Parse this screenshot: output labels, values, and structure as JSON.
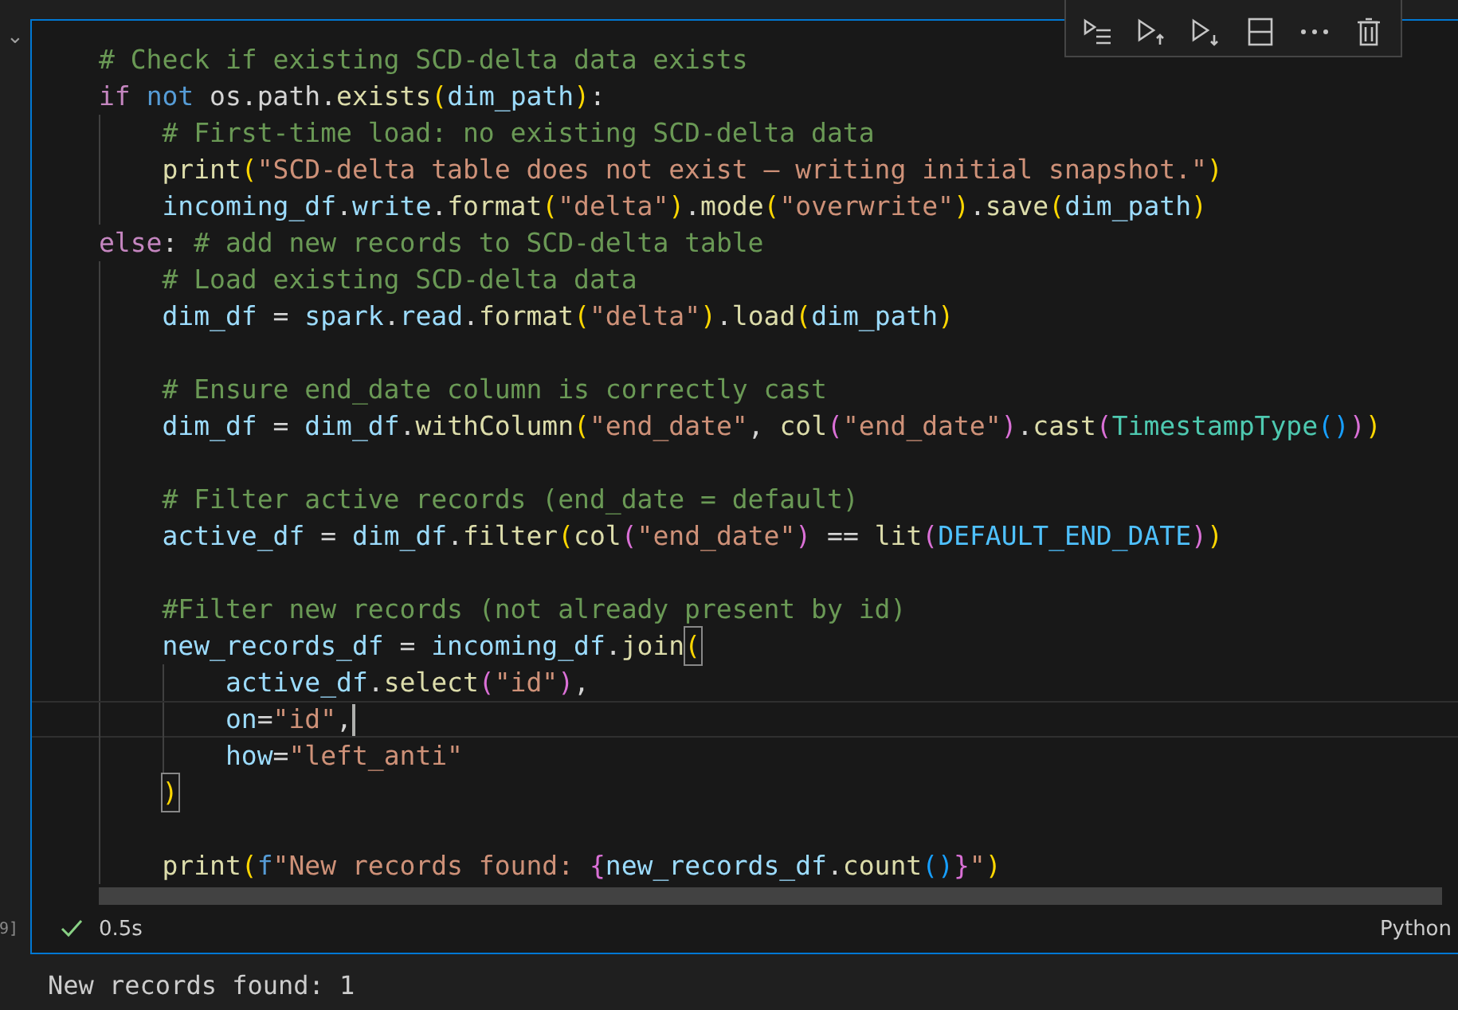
{
  "gutter": {
    "collapse": "⌄",
    "execution_count": "9]"
  },
  "toolbar": {
    "buttons": [
      {
        "kind": "run-by-line"
      },
      {
        "kind": "run-above"
      },
      {
        "kind": "run-below"
      },
      {
        "kind": "split"
      },
      {
        "kind": "more"
      },
      {
        "kind": "delete"
      }
    ]
  },
  "code": {
    "lines": [
      {
        "tokens": [
          {
            "text": "# Check if existing SCD-delta data exists",
            "kind": "comment"
          }
        ]
      },
      {
        "tokens": [
          {
            "text": "if ",
            "kind": "keyword"
          },
          {
            "text": "not",
            "kind": "storage"
          },
          {
            "text": " os.path.",
            "kind": "plain"
          },
          {
            "text": "exists",
            "kind": "func"
          },
          {
            "text": "(",
            "kind": "bracket1"
          },
          {
            "text": "dim_path",
            "kind": "var"
          },
          {
            "text": ")",
            "kind": "bracket1"
          },
          {
            "text": ":",
            "kind": "plain"
          }
        ]
      },
      {
        "tokens": [
          {
            "text": "    # First-time load: no existing SCD-delta data",
            "kind": "comment"
          }
        ]
      },
      {
        "tokens": [
          {
            "text": "    print",
            "kind": "func"
          },
          {
            "text": "(",
            "kind": "bracket1"
          },
          {
            "text": "\"SCD-delta table does not exist — writing initial snapshot.\"",
            "kind": "string"
          },
          {
            "text": ")",
            "kind": "bracket1"
          }
        ]
      },
      {
        "tokens": [
          {
            "text": "    incoming_df",
            "kind": "var"
          },
          {
            "text": ".",
            "kind": "plain"
          },
          {
            "text": "write",
            "kind": "var"
          },
          {
            "text": ".",
            "kind": "plain"
          },
          {
            "text": "format",
            "kind": "func"
          },
          {
            "text": "(",
            "kind": "bracket1"
          },
          {
            "text": "\"delta\"",
            "kind": "string"
          },
          {
            "text": ")",
            "kind": "bracket1"
          },
          {
            "text": ".",
            "kind": "plain"
          },
          {
            "text": "mode",
            "kind": "func"
          },
          {
            "text": "(",
            "kind": "bracket1"
          },
          {
            "text": "\"overwrite\"",
            "kind": "string"
          },
          {
            "text": ")",
            "kind": "bracket1"
          },
          {
            "text": ".",
            "kind": "plain"
          },
          {
            "text": "save",
            "kind": "func"
          },
          {
            "text": "(",
            "kind": "bracket1"
          },
          {
            "text": "dim_path",
            "kind": "var"
          },
          {
            "text": ")",
            "kind": "bracket1"
          }
        ]
      },
      {
        "tokens": [
          {
            "text": "else",
            "kind": "keyword"
          },
          {
            "text": ": ",
            "kind": "plain"
          },
          {
            "text": "# add new records to SCD-delta table",
            "kind": "comment"
          }
        ]
      },
      {
        "tokens": [
          {
            "text": "    # Load existing SCD-delta data",
            "kind": "comment"
          }
        ]
      },
      {
        "tokens": [
          {
            "text": "    dim_df",
            "kind": "var"
          },
          {
            "text": " = ",
            "kind": "plain"
          },
          {
            "text": "spark",
            "kind": "var"
          },
          {
            "text": ".",
            "kind": "plain"
          },
          {
            "text": "read",
            "kind": "var"
          },
          {
            "text": ".",
            "kind": "plain"
          },
          {
            "text": "format",
            "kind": "func"
          },
          {
            "text": "(",
            "kind": "bracket1"
          },
          {
            "text": "\"delta\"",
            "kind": "string"
          },
          {
            "text": ")",
            "kind": "bracket1"
          },
          {
            "text": ".",
            "kind": "plain"
          },
          {
            "text": "load",
            "kind": "func"
          },
          {
            "text": "(",
            "kind": "bracket1"
          },
          {
            "text": "dim_path",
            "kind": "var"
          },
          {
            "text": ")",
            "kind": "bracket1"
          }
        ]
      },
      {
        "kind": "blank"
      },
      {
        "tokens": [
          {
            "text": "    # Ensure end_date column is correctly cast",
            "kind": "comment"
          }
        ]
      },
      {
        "tokens": [
          {
            "text": "    dim_df",
            "kind": "var"
          },
          {
            "text": " = ",
            "kind": "plain"
          },
          {
            "text": "dim_df",
            "kind": "var"
          },
          {
            "text": ".",
            "kind": "plain"
          },
          {
            "text": "withColumn",
            "kind": "func"
          },
          {
            "text": "(",
            "kind": "bracket1"
          },
          {
            "text": "\"end_date\"",
            "kind": "string"
          },
          {
            "text": ", ",
            "kind": "plain"
          },
          {
            "text": "col",
            "kind": "func"
          },
          {
            "text": "(",
            "kind": "bracket2"
          },
          {
            "text": "\"end_date\"",
            "kind": "string"
          },
          {
            "text": ")",
            "kind": "bracket2"
          },
          {
            "text": ".",
            "kind": "plain"
          },
          {
            "text": "cast",
            "kind": "func"
          },
          {
            "text": "(",
            "kind": "bracket2"
          },
          {
            "text": "TimestampType",
            "kind": "class"
          },
          {
            "text": "()",
            "kind": "bracket3"
          },
          {
            "text": ")",
            "kind": "bracket2"
          },
          {
            "text": ")",
            "kind": "bracket1"
          }
        ]
      },
      {
        "kind": "blank"
      },
      {
        "tokens": [
          {
            "text": "    # Filter active records (end_date = default)",
            "kind": "comment"
          }
        ]
      },
      {
        "tokens": [
          {
            "text": "    active_df",
            "kind": "var"
          },
          {
            "text": " = ",
            "kind": "plain"
          },
          {
            "text": "dim_df",
            "kind": "var"
          },
          {
            "text": ".",
            "kind": "plain"
          },
          {
            "text": "filter",
            "kind": "func"
          },
          {
            "text": "(",
            "kind": "bracket1"
          },
          {
            "text": "col",
            "kind": "func"
          },
          {
            "text": "(",
            "kind": "bracket2"
          },
          {
            "text": "\"end_date\"",
            "kind": "string"
          },
          {
            "text": ")",
            "kind": "bracket2"
          },
          {
            "text": " == ",
            "kind": "plain"
          },
          {
            "text": "lit",
            "kind": "func"
          },
          {
            "text": "(",
            "kind": "bracket2"
          },
          {
            "text": "DEFAULT_END_DATE",
            "kind": "constant"
          },
          {
            "text": ")",
            "kind": "bracket2"
          },
          {
            "text": ")",
            "kind": "bracket1"
          }
        ]
      },
      {
        "kind": "blank"
      },
      {
        "tokens": [
          {
            "text": "    #Filter new records (not already present by id)",
            "kind": "comment"
          }
        ]
      },
      {
        "tokens": [
          {
            "text": "    new_records_df",
            "kind": "var"
          },
          {
            "text": " = ",
            "kind": "plain"
          },
          {
            "text": "incoming_df",
            "kind": "var"
          },
          {
            "text": ".",
            "kind": "plain"
          },
          {
            "text": "join",
            "kind": "func"
          },
          {
            "text": "(",
            "kind": "bracket1",
            "matched": true
          }
        ]
      },
      {
        "tokens": [
          {
            "text": "        active_df",
            "kind": "var"
          },
          {
            "text": ".",
            "kind": "plain"
          },
          {
            "text": "select",
            "kind": "func"
          },
          {
            "text": "(",
            "kind": "bracket2"
          },
          {
            "text": "\"id\"",
            "kind": "string"
          },
          {
            "text": ")",
            "kind": "bracket2"
          },
          {
            "text": ",",
            "kind": "plain"
          }
        ]
      },
      {
        "current": true,
        "tokens": [
          {
            "text": "        on",
            "kind": "var"
          },
          {
            "text": "=",
            "kind": "plain"
          },
          {
            "text": "\"id\"",
            "kind": "string"
          },
          {
            "text": ",",
            "kind": "plain"
          }
        ]
      },
      {
        "tokens": [
          {
            "text": "        how",
            "kind": "var"
          },
          {
            "text": "=",
            "kind": "plain"
          },
          {
            "text": "\"left_anti\"",
            "kind": "string"
          }
        ]
      },
      {
        "tokens": [
          {
            "text": "    )",
            "kind": "bracket1",
            "matched": true
          }
        ]
      },
      {
        "kind": "blank"
      },
      {
        "tokens": [
          {
            "text": "    print",
            "kind": "func"
          },
          {
            "text": "(",
            "kind": "bracket1"
          },
          {
            "text": "f",
            "kind": "storage"
          },
          {
            "text": "\"New records found: ",
            "kind": "string"
          },
          {
            "text": "{",
            "kind": "bracket2"
          },
          {
            "text": "new_records_df",
            "kind": "var"
          },
          {
            "text": ".",
            "kind": "plain"
          },
          {
            "text": "count",
            "kind": "func"
          },
          {
            "text": "()",
            "kind": "bracket3"
          },
          {
            "text": "}",
            "kind": "bracket2"
          },
          {
            "text": "\"",
            "kind": "string"
          },
          {
            "text": ")",
            "kind": "bracket1"
          }
        ]
      }
    ]
  },
  "status": {
    "succeeded": true,
    "duration": "0.5s",
    "language": "Python"
  },
  "output": [
    "New records found: 1"
  ]
}
